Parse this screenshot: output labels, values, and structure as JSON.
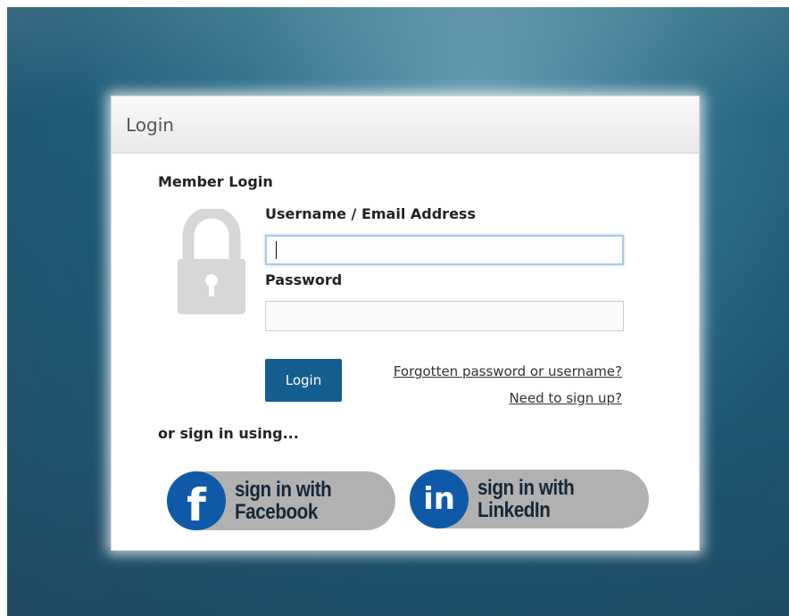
{
  "dialog": {
    "title": "Login"
  },
  "form": {
    "heading": "Member Login",
    "username_label": "Username / Email Address",
    "username_value": "",
    "password_label": "Password",
    "password_value": "",
    "login_button": "Login",
    "forgot_link": "Forgotten password or username?",
    "signup_link": "Need to sign up?",
    "social_heading": "or sign in using..."
  },
  "social": {
    "facebook": {
      "line1": "sign in with",
      "line2": "Facebook",
      "icon": "f",
      "color": "#0e5aa8"
    },
    "linkedin": {
      "line1": "sign in with",
      "line2": "LinkedIn",
      "icon": "in",
      "color": "#0e5aa8"
    }
  },
  "colors": {
    "accent": "#145f8f",
    "background": "#2f6f88"
  }
}
